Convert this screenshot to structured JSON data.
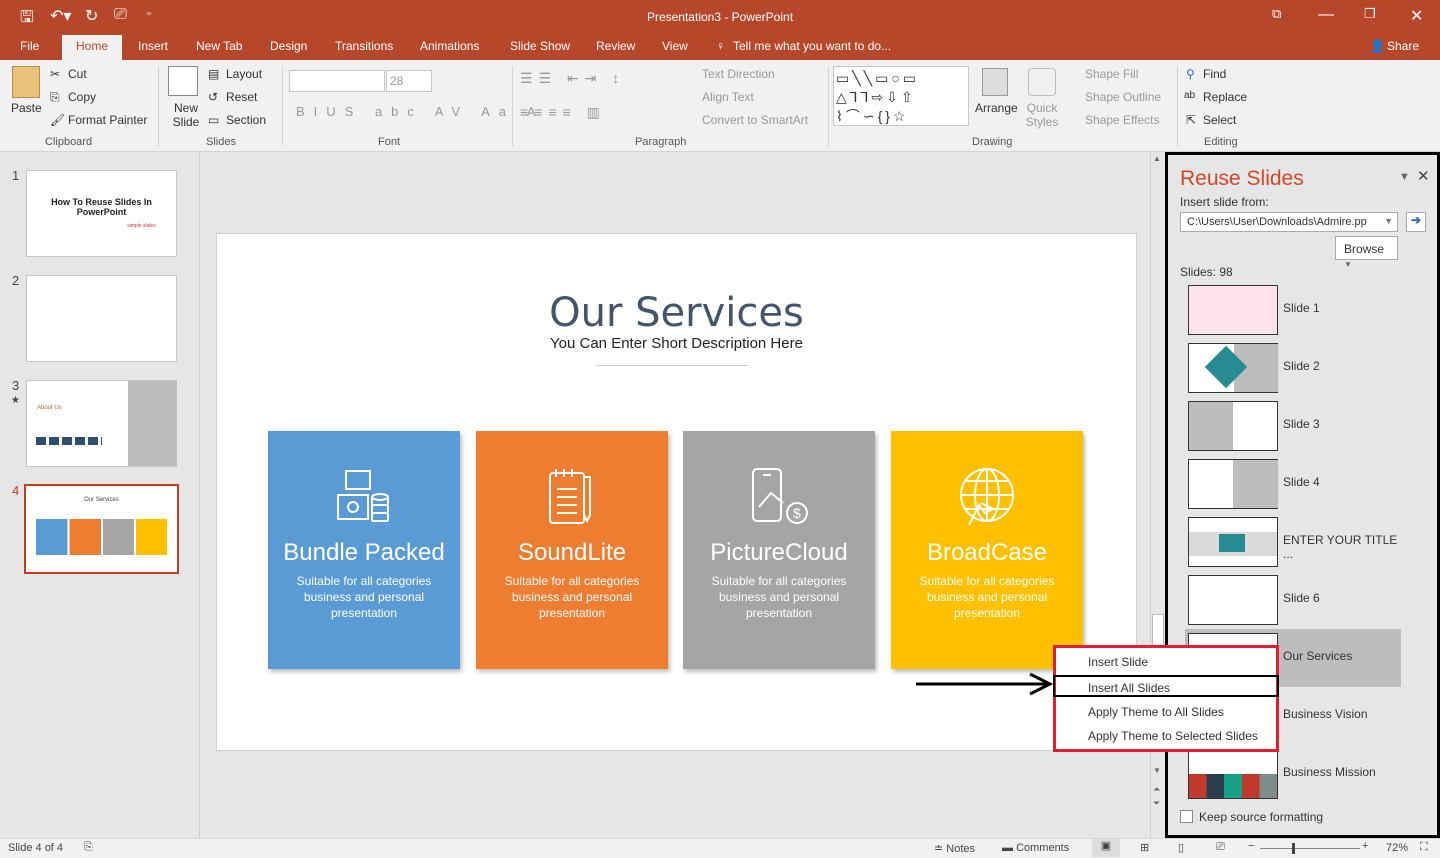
{
  "app": {
    "title": "Presentation3 - PowerPoint",
    "share": "Share",
    "tell_me": "Tell me what you want to do..."
  },
  "tabs": [
    "File",
    "Home",
    "Insert",
    "New Tab",
    "Design",
    "Transitions",
    "Animations",
    "Slide Show",
    "Review",
    "View"
  ],
  "ribbon": {
    "clipboard": {
      "paste": "Paste",
      "cut": "Cut",
      "copy": "Copy",
      "format_painter": "Format Painter",
      "label": "Clipboard"
    },
    "slides": {
      "new_slide": "New Slide",
      "layout": "Layout",
      "reset": "Reset",
      "section": "Section",
      "label": "Slides"
    },
    "font": {
      "size": "28",
      "label": "Font"
    },
    "paragraph": {
      "text_direction": "Text Direction",
      "align_text": "Align Text",
      "convert": "Convert to SmartArt",
      "label": "Paragraph"
    },
    "drawing": {
      "arrange": "Arrange",
      "quick_styles": "Quick Styles",
      "shape_fill": "Shape Fill",
      "shape_outline": "Shape Outline",
      "shape_effects": "Shape Effects",
      "label": "Drawing"
    },
    "editing": {
      "find": "Find",
      "replace": "Replace",
      "select": "Select",
      "label": "Editing"
    }
  },
  "thumbnails": [
    {
      "num": "1",
      "title": "How To Reuse Slides In PowerPoint",
      "brand": "simple slides"
    },
    {
      "num": "2"
    },
    {
      "num": "3",
      "title": "About Us"
    },
    {
      "num": "4",
      "title": "Our Services"
    }
  ],
  "slide": {
    "title": "Our Services",
    "subtitle": "You Can Enter Short Description Here",
    "cards": [
      {
        "title": "Bundle Packed",
        "desc": "Suitable for all categories business and personal presentation",
        "color": "#5b9bd5",
        "icon": "money-stack-icon"
      },
      {
        "title": "SoundLite",
        "desc": "Suitable for all categories business and personal presentation",
        "color": "#ed7d31",
        "icon": "clipboard-pen-icon"
      },
      {
        "title": "PictureCloud",
        "desc": "Suitable for all categories business and personal presentation",
        "color": "#a5a5a5",
        "icon": "phone-dollar-icon"
      },
      {
        "title": "BroadCase",
        "desc": "Suitable for all categories business and personal presentation",
        "color": "#ffc000",
        "icon": "globe-arrow-icon"
      }
    ]
  },
  "reuse": {
    "title": "Reuse Slides",
    "insert_from": "Insert slide from:",
    "path": "C:\\Users\\User\\Downloads\\Admire.pp",
    "browse": "Browse",
    "count": "Slides: 98",
    "keep": "Keep source formatting",
    "items": [
      "Slide 1",
      "Slide 2",
      "Slide 3",
      "Slide 4",
      "ENTER YOUR TITLE ...",
      "Slide 6",
      "Our Services",
      "Business Vision",
      "Business Mission"
    ]
  },
  "context_menu": [
    "Insert Slide",
    "Insert All Slides",
    "Apply Theme to All Slides",
    "Apply Theme to Selected Slides"
  ],
  "status": {
    "slide": "Slide 4 of 4",
    "notes": "Notes",
    "comments": "Comments",
    "zoom": "72%"
  }
}
